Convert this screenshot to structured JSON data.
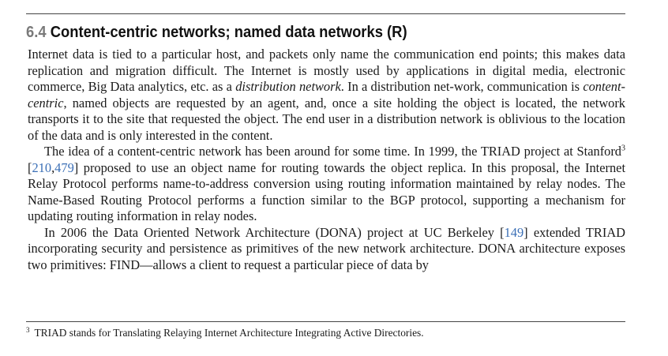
{
  "section": {
    "number": "6.4",
    "title": "Content-centric networks; named data networks (R)"
  },
  "paragraphs": [
    {
      "s1": "Internet data is tied to a particular host, and packets only name the communication end points; this makes data replication and migration difficult. The Internet is mostly used by applications in digital media, electronic commerce, Big Data analytics, etc. as a ",
      "em1": "distribution network",
      "s2": ". In a distribution net-work, communication is ",
      "em2": "content-centric",
      "s3": ", named objects are requested by an agent, and, once a site holding the object is located, the network transports it to the site that requested the object. The end user in a distribution network is oblivious to the location of the data and is only interested in the content."
    },
    {
      "s1": "The idea of a content-centric network has been around for some time. In 1999, the TRIAD project at Stanford",
      "fn": "3",
      "s2": " [",
      "ref1": "210",
      "comma": ",",
      "ref2": "479",
      "s3": "] proposed to use an object name for routing towards the object replica. In this proposal, the Internet Relay Protocol performs name-to-address conversion using routing information maintained by relay nodes. The Name-Based Routing Protocol performs a function similar to the BGP protocol, supporting a mechanism for updating routing information in relay nodes."
    },
    {
      "s1": "In 2006 the Data Oriented Network Architecture (DONA) project at UC Berkeley [",
      "ref1": "149",
      "s2": "] extended TRIAD incorporating security and persistence as primitives of the new network architecture. DONA architecture exposes two primitives: FIND—allows a client to request a particular piece of data by"
    }
  ],
  "footnote": {
    "number": "3",
    "text": "TRIAD stands for Translating Relaying Internet Architecture Integrating Active Directories."
  },
  "colors": {
    "reference_link": "#3b6fb6",
    "section_number": "#7a7a7a"
  }
}
